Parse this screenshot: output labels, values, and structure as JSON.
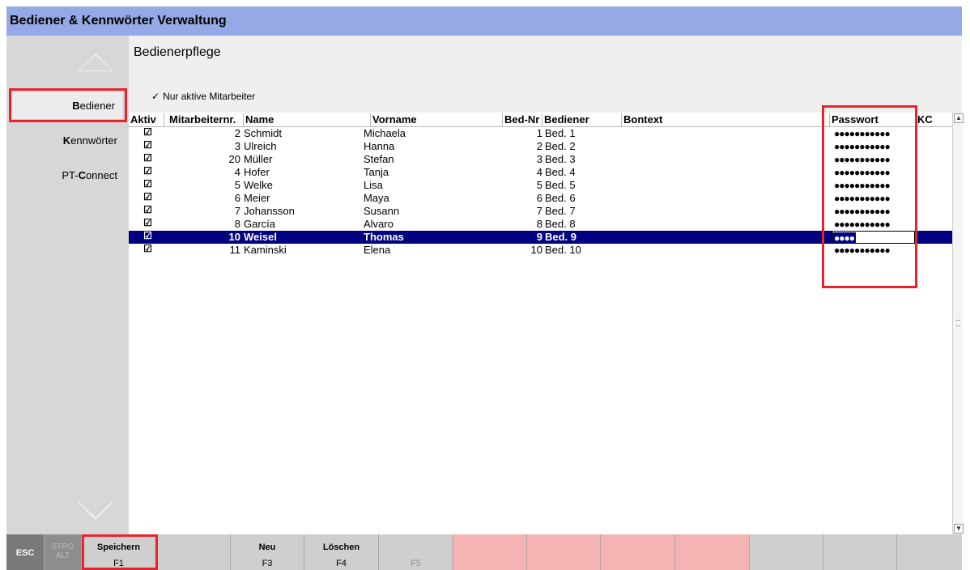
{
  "window": {
    "title": "Bediener & Kennwörter Verwaltung"
  },
  "sidebar": {
    "items": [
      {
        "label": "Bediener",
        "hotkey": "B",
        "rest": "ediener",
        "active": true
      },
      {
        "label": "Kennwörter",
        "hotkey": "K",
        "rest": "ennwörter"
      },
      {
        "label": "PT-Connect",
        "prefix": "PT-",
        "hotkey": "C",
        "rest": "onnect"
      }
    ]
  },
  "main": {
    "title": "Bedienerpflege",
    "filter": {
      "check": "✓",
      "label": "Nur aktive Mitarbeiter"
    }
  },
  "grid": {
    "columns": {
      "aktiv": "Aktiv",
      "mitarbeiternr": "Mitarbeiternr.",
      "name": "Name",
      "vorname": "Vorname",
      "bednr": "Bed-Nr",
      "bediener": "Bediener",
      "bontext": "Bontext",
      "passwort": "Passwort",
      "kc": "KC"
    },
    "rows": [
      {
        "aktiv": "☑",
        "nr": "2",
        "name": "Schmidt",
        "vorname": "Michaela",
        "bednr": "1",
        "bediener": "Bed. 1",
        "bontext": "",
        "passwort": "●●●●●●●●●●●"
      },
      {
        "aktiv": "☑",
        "nr": "3",
        "name": "Ulreich",
        "vorname": "Hanna",
        "bednr": "2",
        "bediener": "Bed. 2",
        "bontext": "",
        "passwort": "●●●●●●●●●●●"
      },
      {
        "aktiv": "☑",
        "nr": "20",
        "name": "Müller",
        "vorname": "Stefan",
        "bednr": "3",
        "bediener": "Bed. 3",
        "bontext": "",
        "passwort": "●●●●●●●●●●●"
      },
      {
        "aktiv": "☑",
        "nr": "4",
        "name": "Hofer",
        "vorname": "Tanja",
        "bednr": "4",
        "bediener": "Bed. 4",
        "bontext": "",
        "passwort": "●●●●●●●●●●●"
      },
      {
        "aktiv": "☑",
        "nr": "5",
        "name": "Welke",
        "vorname": "Lisa",
        "bednr": "5",
        "bediener": "Bed. 5",
        "bontext": "",
        "passwort": "●●●●●●●●●●●"
      },
      {
        "aktiv": "☑",
        "nr": "6",
        "name": "Meier",
        "vorname": "Maya",
        "bednr": "6",
        "bediener": "Bed. 6",
        "bontext": "",
        "passwort": "●●●●●●●●●●●"
      },
      {
        "aktiv": "☑",
        "nr": "7",
        "name": "Johansson",
        "vorname": "Susann",
        "bednr": "7",
        "bediener": "Bed. 7",
        "bontext": "",
        "passwort": "●●●●●●●●●●●"
      },
      {
        "aktiv": "☑",
        "nr": "8",
        "name": "García",
        "vorname": "Alvaro",
        "bednr": "8",
        "bediener": "Bed. 8",
        "bontext": "",
        "passwort": "●●●●●●●●●●●"
      },
      {
        "aktiv": "☑",
        "nr": "10",
        "name": "Weisel",
        "vorname": "Thomas",
        "bednr": "9",
        "bediener": "Bed. 9",
        "bontext": "",
        "passwort": "●●●●",
        "selected": true,
        "editing": true
      },
      {
        "aktiv": "☑",
        "nr": "11",
        "name": "Kaminski",
        "vorname": "Elena",
        "bednr": "10",
        "bediener": "Bed. 10",
        "bontext": "",
        "passwort": "●●●●●●●●●●●"
      }
    ]
  },
  "fkeys": {
    "esc": "ESC",
    "strg": "STRG",
    "alt": "ALT",
    "save": {
      "label": "Speichern",
      "key": "F1"
    },
    "new": {
      "label": "Neu",
      "key": "F3"
    },
    "delete": {
      "label": "Löschen",
      "key": "F4"
    },
    "f5": {
      "label": "",
      "key": "F5"
    }
  },
  "colors": {
    "titlebar": "#94a9e6",
    "selection": "#000080",
    "highlight_box": "#e8232b",
    "pink_keys": "#f5b3b3"
  }
}
